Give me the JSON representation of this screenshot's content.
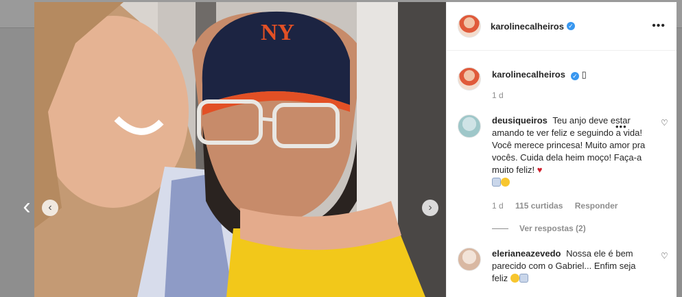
{
  "post": {
    "username": "karolinecalheiros",
    "verified_glyph": "✓",
    "more_glyph": "•••",
    "caption_glyph": "▯",
    "caption_age": "1 d",
    "prev_glyph": "‹",
    "next_glyph": "›",
    "back_glyph": "‹"
  },
  "comments": [
    {
      "username": "deusiqueiros",
      "text": "Teu anjo deve estar amando te ver feliz e seguindo a vida! Você merece princesa! Muito amor pra vocês. Cuida dela heim moço! Faça-a muito feliz!",
      "heart_emoji": "♥",
      "age": "1 d",
      "likes": "115 curtidas",
      "reply": "Responder",
      "view_replies": "Ver respostas (2)",
      "like_icon": "♡",
      "options_glyph": "•••"
    },
    {
      "username": "elerianeazevedo",
      "text": "Nossa ele é bem parecido com o Gabriel... Enfim seja feliz",
      "like_icon": "♡"
    }
  ],
  "icons": [
    "chevron-left-icon",
    "chevron-right-icon",
    "verified-icon",
    "more-options-icon",
    "heart-outline-icon",
    "heart-emoji-icon",
    "smile-emoji-icon"
  ],
  "colors": {
    "verified": "#3897f0",
    "text": "#262626",
    "secondary": "#8e8e8e",
    "heart": "#d11f2d"
  }
}
